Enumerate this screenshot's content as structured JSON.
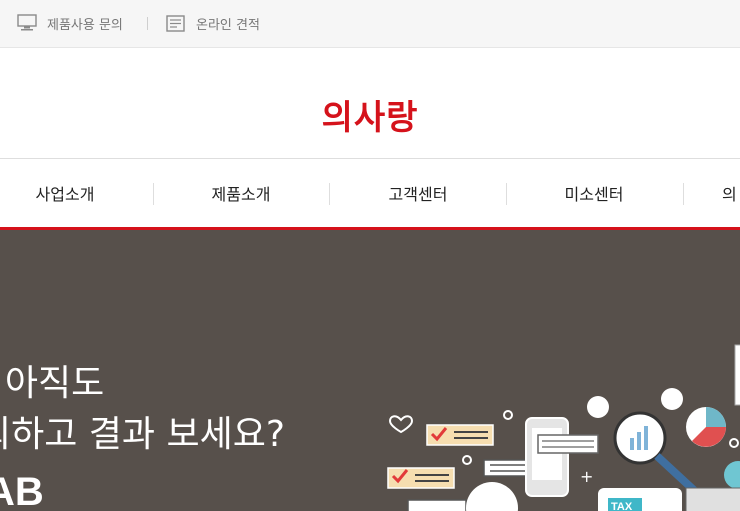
{
  "utility_bar": {
    "inquiry_label": "제품사용 문의",
    "inquiry_icon": "monitor-icon",
    "estimate_label": "온라인 견적",
    "estimate_icon": "document-icon"
  },
  "brand": {
    "logo_text": "의사랑",
    "color": "#d5121b"
  },
  "nav": {
    "items": [
      "사업소개",
      "제품소개",
      "고객센터",
      "미소센터",
      "의"
    ]
  },
  "hero": {
    "line1": ", 아직도",
    "line2": "뢰하고 결과 보세요?",
    "line3": "AB",
    "tax_label": "TAX",
    "background": "#57504b"
  }
}
